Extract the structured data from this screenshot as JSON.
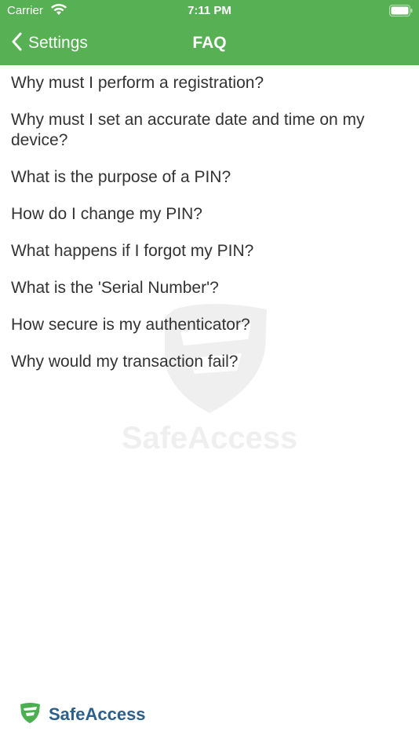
{
  "status_bar": {
    "carrier": "Carrier",
    "time": "7:11 PM",
    "icons": [
      "wifi-icon",
      "battery-icon"
    ]
  },
  "nav": {
    "back_label": "Settings",
    "title": "FAQ"
  },
  "faq_items": [
    "Why must I perform a registration?",
    "Why must I set an accurate date and time on my device?",
    "What is the purpose of a PIN?",
    "How do I change my PIN?",
    "What happens if I forgot my PIN?",
    "What is the 'Serial Number'?",
    "How secure is my authenticator?",
    "Why would my transaction fail?"
  ],
  "watermark": {
    "text": "SafeAccess"
  },
  "footer": {
    "brand": "SafeAccess"
  },
  "colors": {
    "header_bg": "#58b055",
    "brand_green": "#4caf50",
    "brand_blue": "#2c5f8a"
  }
}
